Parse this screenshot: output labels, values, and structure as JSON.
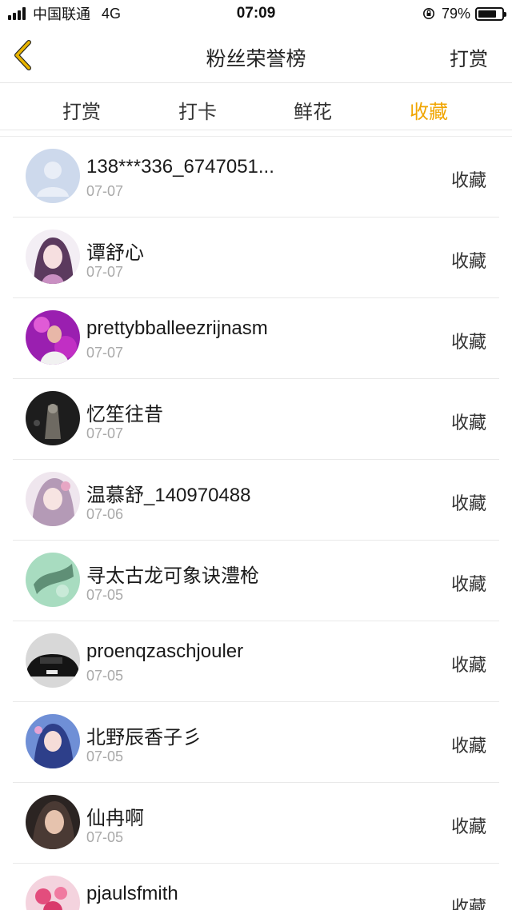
{
  "status_bar": {
    "carrier": "中国联通",
    "network": "4G",
    "time": "07:09",
    "battery": "79%",
    "battery_level": 0.79
  },
  "nav": {
    "title": "粉丝荣誉榜",
    "action_label": "打赏",
    "back_icon": "chevron-left-icon"
  },
  "tabs": [
    {
      "label": "打赏",
      "active": false
    },
    {
      "label": "打卡",
      "active": false
    },
    {
      "label": "鲜花",
      "active": false
    },
    {
      "label": "收藏",
      "active": true
    }
  ],
  "colors": {
    "accent": "#f0a500",
    "back_arrow": "#e8b400"
  },
  "fans": [
    {
      "name": "138***336_6747051...",
      "date": "07-07",
      "action": "收藏"
    },
    {
      "name": "谭舒心",
      "date": "07-07",
      "action": "收藏"
    },
    {
      "name": "prettybballeezrijnasm",
      "date": "07-07",
      "action": "收藏"
    },
    {
      "name": "忆笙往昔",
      "date": "07-07",
      "action": "收藏"
    },
    {
      "name": "温慕舒_140970488",
      "date": "07-06",
      "action": "收藏"
    },
    {
      "name": "寻太古龙可象诀澧枪",
      "date": "07-05",
      "action": "收藏"
    },
    {
      "name": "proenqzaschjouler",
      "date": "07-05",
      "action": "收藏"
    },
    {
      "name": "北野辰香子彡",
      "date": "07-05",
      "action": "收藏"
    },
    {
      "name": "仙冉啊",
      "date": "07-05",
      "action": "收藏"
    },
    {
      "name": "pjaulsfmith",
      "date": "",
      "action": "收藏"
    }
  ]
}
